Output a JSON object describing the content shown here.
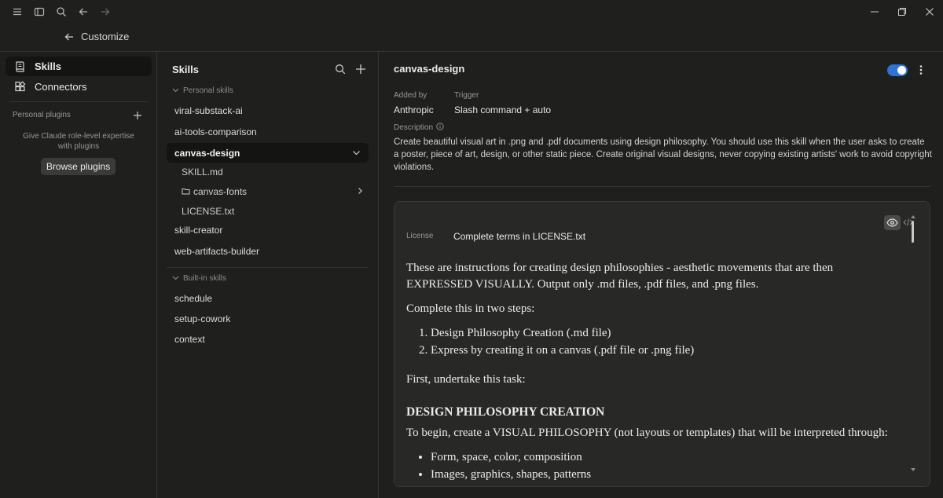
{
  "topbar": {
    "customize_label": "Customize"
  },
  "sidebar": {
    "items": [
      {
        "label": "Skills",
        "icon": "skills-icon",
        "active": true
      },
      {
        "label": "Connectors",
        "icon": "connectors-icon",
        "active": false
      }
    ],
    "personal_plugins_label": "Personal plugins",
    "plugins_description": "Give Claude role-level expertise with plugins",
    "browse_button": "Browse plugins"
  },
  "skills_pane": {
    "title": "Skills",
    "personal_header": "Personal skills",
    "personal_skills": [
      "viral-substack-ai",
      "ai-tools-comparison",
      "canvas-design"
    ],
    "selected_skill_files": [
      "SKILL.md",
      "canvas-fonts",
      "LICENSE.txt"
    ],
    "personal_skills_after": [
      "skill-creator",
      "web-artifacts-builder"
    ],
    "builtin_header": "Built-in skills",
    "builtin_skills": [
      "schedule",
      "setup-cowork",
      "context"
    ]
  },
  "detail": {
    "title": "canvas-design",
    "enabled": true,
    "added_by_label": "Added by",
    "added_by_value": "Anthropic",
    "trigger_label": "Trigger",
    "trigger_value": "Slash command + auto",
    "description_label": "Description",
    "description": "Create beautiful visual art in .png and .pdf documents using design philosophy. You should use this skill when the user asks to create a poster, piece of art, design, or other static piece. Create original visual designs, never copying existing artists' work to avoid copyright violations.",
    "license_label": "License",
    "license_value": "Complete terms in LICENSE.txt",
    "doc": {
      "intro": "These are instructions for creating design philosophies - aesthetic movements that are then EXPRESSED VISUALLY. Output only .md files, .pdf files, and .png files.",
      "steps_intro": "Complete this in two steps:",
      "steps": [
        "Design Philosophy Creation (.md file)",
        "Express by creating it on a canvas (.pdf file or .png file)"
      ],
      "first_task": "First, undertake this task:",
      "heading": "DESIGN PHILOSOPHY CREATION",
      "begin": "To begin, create a VISUAL PHILOSOPHY (not layouts or templates) that will be interpreted through:",
      "bullets": [
        "Form, space, color, composition",
        "Images, graphics, shapes, patterns"
      ]
    }
  },
  "colors": {
    "background": "#1f1f1e",
    "accent": "#2e73d6",
    "active_row": "#141413"
  }
}
